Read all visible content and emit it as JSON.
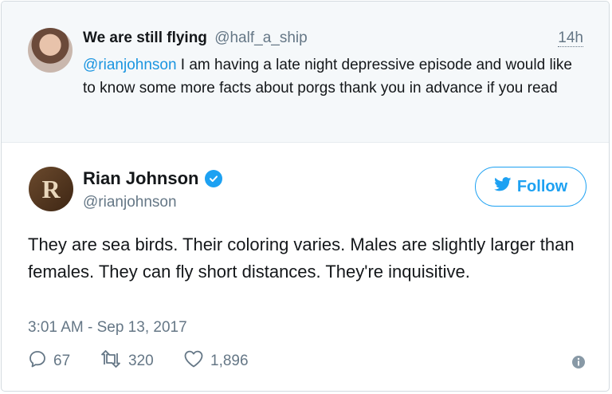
{
  "parent_tweet": {
    "author_name": "We are still flying",
    "author_handle": "@half_a_ship",
    "time": "14h",
    "mention": "@rianjohnson",
    "text": " I am having a late night depressive episode and would like to know some more facts about porgs thank you in advance if you read"
  },
  "tweet": {
    "avatar_letter": "R",
    "author_name": "Rian Johnson",
    "author_handle": "@rianjohnson",
    "follow_label": "Follow",
    "text": "They are sea birds. Their coloring varies. Males are slightly larger than females. They can fly short distances. They're inquisitive.",
    "timestamp": "3:01 AM - Sep 13, 2017",
    "replies": "67",
    "retweets": "320",
    "likes": "1,896"
  },
  "colors": {
    "accent": "#1da1f2",
    "link": "#1b95e0",
    "muted": "#657786",
    "parent_bg": "#f5f8fa"
  },
  "icons": [
    "verified-badge-icon",
    "twitter-bird-icon",
    "reply-icon",
    "retweet-icon",
    "like-icon",
    "info-icon"
  ]
}
